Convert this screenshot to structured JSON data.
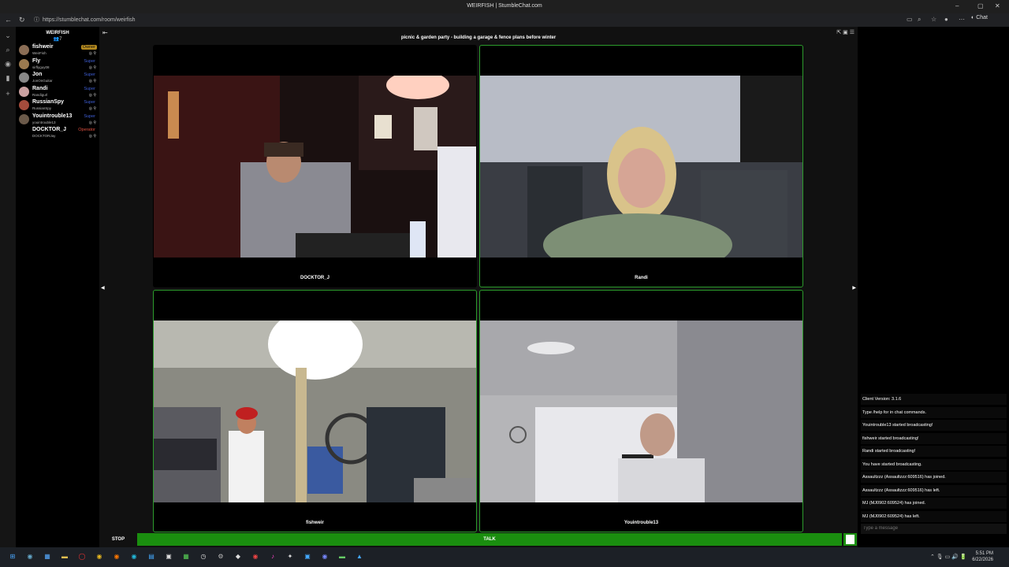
{
  "browser": {
    "window_title": "WEIRFISH | StumbleChat.com",
    "url": "https://stumblechat.com/room/weirfish",
    "chat_label": "Chat",
    "controls": {
      "minimize": "–",
      "maximize": "▢",
      "close": "✕"
    }
  },
  "room": {
    "name": "WEIRFISH",
    "count": "7",
    "topic": "picnic  &  garden party  -  building a garage & fence plans before winter"
  },
  "users": [
    {
      "nick": "fishweir",
      "username": "WeirFish",
      "role": "Owner",
      "role_color": "#b58a1e",
      "avatar_color": "#8a6d55"
    },
    {
      "nick": "Fly",
      "username": "sirflyguy08",
      "role": "Super",
      "role_color": "#3f5fd6",
      "avatar_color": "#9b7a4f"
    },
    {
      "nick": "Jon",
      "username": "JonOnGuitar",
      "role": "Super",
      "role_color": "#3f5fd6",
      "avatar_color": "#888888"
    },
    {
      "nick": "Randi",
      "username": "Randigurl",
      "role": "Super",
      "role_color": "#3f5fd6",
      "avatar_color": "#c9a0a0"
    },
    {
      "nick": "RussianSpy",
      "username": "RussianSpy",
      "role": "Super",
      "role_color": "#3f5fd6",
      "avatar_color": "#a44c3c"
    },
    {
      "nick": "Youintrouble13",
      "username": "youintrouble13",
      "role": "Super",
      "role_color": "#3f5fd6",
      "avatar_color": "#6b5a4a"
    },
    {
      "nick": "DOCKTOR_J",
      "username": "DOCKTORJay",
      "role": "Operator",
      "role_color": "#c0392b",
      "avatar_color": "#000000"
    }
  ],
  "cams": [
    {
      "name": "DOCKTOR_J",
      "active": false
    },
    {
      "name": "Randi",
      "active": true
    },
    {
      "name": "fishweir",
      "active": true
    },
    {
      "name": "Youintrouble13",
      "active": true
    }
  ],
  "controls": {
    "stop": "STOP",
    "talk": "TALK"
  },
  "chat": {
    "messages": [
      "Client Version: 3.1.6",
      "Type /help for in chat commands.",
      "Youintrouble13 started broadcasting!",
      "fishweir started broadcasting!",
      "Randi started broadcasting!",
      "You have started broadcasting.",
      "Assaultzzz (Assaultzzz:609516) has joined.",
      "Assaultzzz (Assaultzzz:609516) has left.",
      "MJ (MJ0902:609524) has joined.",
      "MJ (MJ0902:609524) has left."
    ],
    "placeholder": "Type a message"
  },
  "taskbar": {
    "time": "5:51 PM",
    "date": "6/22/2026"
  },
  "colors": {
    "accent_green": "#1a8e0f",
    "cam_border": "#2c9c2c"
  }
}
